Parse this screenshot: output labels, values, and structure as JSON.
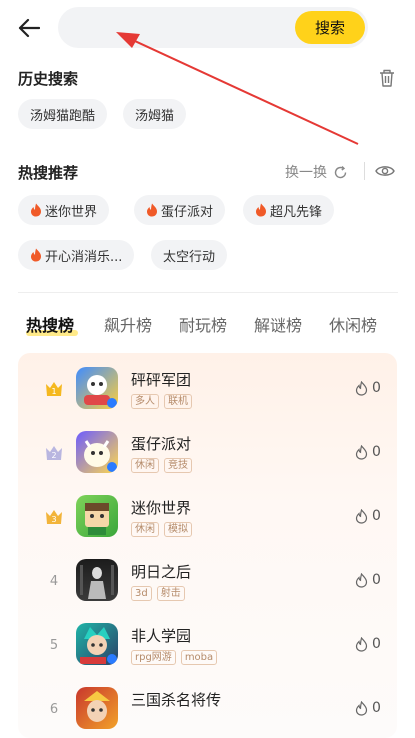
{
  "header": {
    "search_placeholder": "",
    "search_button": "搜索"
  },
  "history": {
    "title": "历史搜索",
    "items": [
      "汤姆猫跑酷",
      "汤姆猫"
    ]
  },
  "hot": {
    "title": "热搜推荐",
    "swap_label": "换一换",
    "items": [
      "迷你世界",
      "蛋仔派对",
      "超凡先锋",
      "开心消消乐...",
      "太空行动"
    ]
  },
  "tabs": [
    "热搜榜",
    "飙升榜",
    "耐玩榜",
    "解谜榜",
    "休闲榜"
  ],
  "ranking": [
    {
      "rank": "1",
      "name": "砰砰军团",
      "tags": [
        "多人",
        "联机"
      ],
      "heat": "0"
    },
    {
      "rank": "2",
      "name": "蛋仔派对",
      "tags": [
        "休闲",
        "竞技"
      ],
      "heat": "0"
    },
    {
      "rank": "3",
      "name": "迷你世界",
      "tags": [
        "休闲",
        "模拟"
      ],
      "heat": "0"
    },
    {
      "rank": "4",
      "name": "明日之后",
      "tags": [
        "3d",
        "射击"
      ],
      "heat": "0"
    },
    {
      "rank": "5",
      "name": "非人学园",
      "tags": [
        "rpg网游",
        "moba"
      ],
      "heat": "0"
    },
    {
      "rank": "6",
      "name": "三国杀名将传",
      "tags": [],
      "heat": "0"
    }
  ],
  "colors": {
    "accent": "#ffd21a",
    "fire": "#f05a28",
    "annotation_arrow": "#e53935",
    "gold": "#f5b81f",
    "silver": "#b9b6e0",
    "bronze": "#f2b43a"
  },
  "icons": [
    "back-arrow-icon",
    "trash-icon",
    "fire-icon",
    "refresh-icon",
    "eye-icon",
    "crown-icon",
    "flame-outline-icon"
  ]
}
